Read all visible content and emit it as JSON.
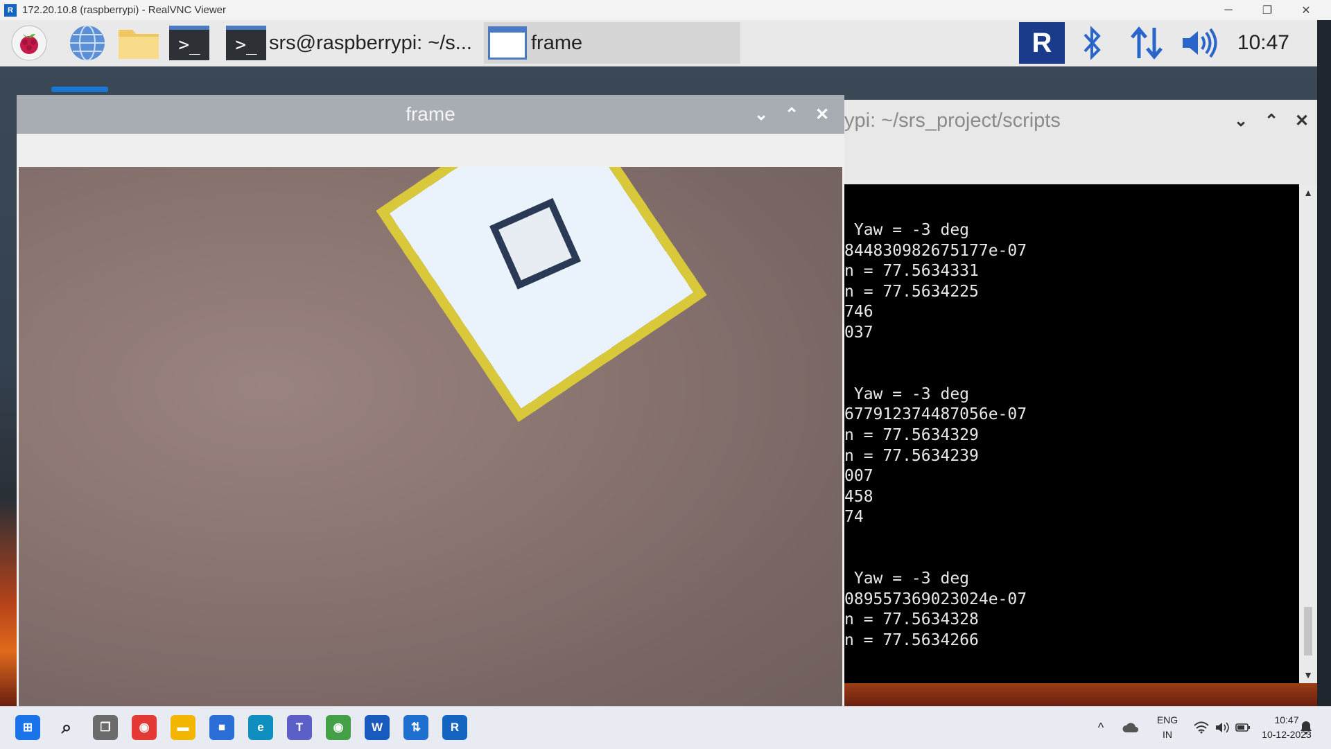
{
  "viewer": {
    "title": "172.20.10.8 (raspberrypi) - RealVNC Viewer",
    "app_icon": "realvnc-icon",
    "controls": {
      "minimize": "─",
      "restore": "❐",
      "close": "✕"
    }
  },
  "rpi_panel": {
    "launchers": [
      "raspberry-menu-icon",
      "web-browser-icon",
      "file-manager-icon",
      "terminal-icon"
    ],
    "terminal_glyph": ">_",
    "tasks": [
      {
        "label": "srs@raspberrypi: ~/s...",
        "active": false
      },
      {
        "label": "frame",
        "active": true
      }
    ],
    "tray_icons": [
      "vnc-icon",
      "bluetooth-icon",
      "network-transfer-icon",
      "volume-icon"
    ],
    "vnc_glyph": "R",
    "clock": "10:47"
  },
  "frame_window": {
    "title": "frame",
    "buttons": {
      "minimize": "⌄",
      "maximize": "⌃",
      "close": "✕"
    }
  },
  "terminal_window": {
    "title": "ypi: ~/srs_project/scripts",
    "buttons": {
      "minimize": "⌄",
      "maximize": "⌃",
      "close": "✕"
    },
    "lines": [
      " Yaw = -3 deg",
      "844830982675177e-07",
      "n = 77.5634331",
      "n = 77.5634225",
      "746",
      "037",
      "",
      "",
      " Yaw = -3 deg",
      "677912374487056e-07",
      "n = 77.5634329",
      "n = 77.5634239",
      "007",
      "458",
      "74",
      "",
      "",
      " Yaw = -3 deg",
      "089557369023024e-07",
      "n = 77.5634328",
      "n = 77.5634266"
    ],
    "scroll_up": "▲",
    "scroll_down": "▼"
  },
  "taskbar": {
    "apps": [
      {
        "name": "start-button",
        "color": "#1a73e8",
        "glyph": "⊞"
      },
      {
        "name": "search-icon",
        "color": "transparent",
        "glyph": "⌕"
      },
      {
        "name": "task-view-icon",
        "color": "#6b6b6b",
        "glyph": "❐"
      },
      {
        "name": "chrome-icon",
        "color": "#e53935",
        "glyph": "◉"
      },
      {
        "name": "file-explorer-icon",
        "color": "#f2b600",
        "glyph": "▬"
      },
      {
        "name": "microsoft-store-icon",
        "color": "#2b6fd6",
        "glyph": "■"
      },
      {
        "name": "edge-icon",
        "color": "#0f8fbf",
        "glyph": "e"
      },
      {
        "name": "teams-icon",
        "color": "#5b5fc7",
        "glyph": "T"
      },
      {
        "name": "chrome-profile-icon",
        "color": "#43a047",
        "glyph": "◉"
      },
      {
        "name": "word-icon",
        "color": "#185abd",
        "glyph": "W"
      },
      {
        "name": "network-app-icon",
        "color": "#1e6fd0",
        "glyph": "⇅"
      },
      {
        "name": "realvnc-taskbar-icon",
        "color": "#1565c0",
        "glyph": "R"
      }
    ],
    "tray": {
      "chevron": "^",
      "language": "ENG",
      "region": "IN",
      "time": "10:47",
      "date": "10-12-2023"
    }
  }
}
